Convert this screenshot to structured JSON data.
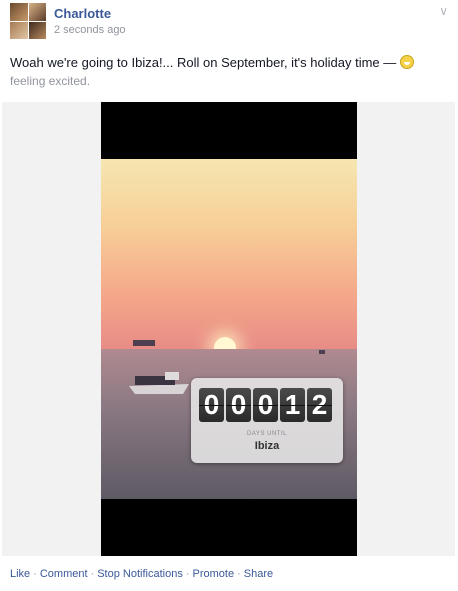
{
  "post": {
    "author": "Charlotte",
    "timestamp": "2 seconds ago",
    "status_text": "Woah we're going to Ibiza!... Roll on September, it's holiday time — ",
    "feeling": "feeling excited.",
    "emoji_icon": "excited-face-icon"
  },
  "photo": {
    "counter_digits": [
      "0",
      "0",
      "0",
      "1",
      "2"
    ],
    "days_until_label": "DAYS UNTIL",
    "destination": "Ibiza"
  },
  "actions": {
    "like": "Like",
    "comment": "Comment",
    "stop_notifications": "Stop Notifications",
    "promote": "Promote",
    "share": "Share",
    "separator": "·"
  },
  "colors": {
    "link": "#3b5998",
    "muted": "#90949c"
  }
}
